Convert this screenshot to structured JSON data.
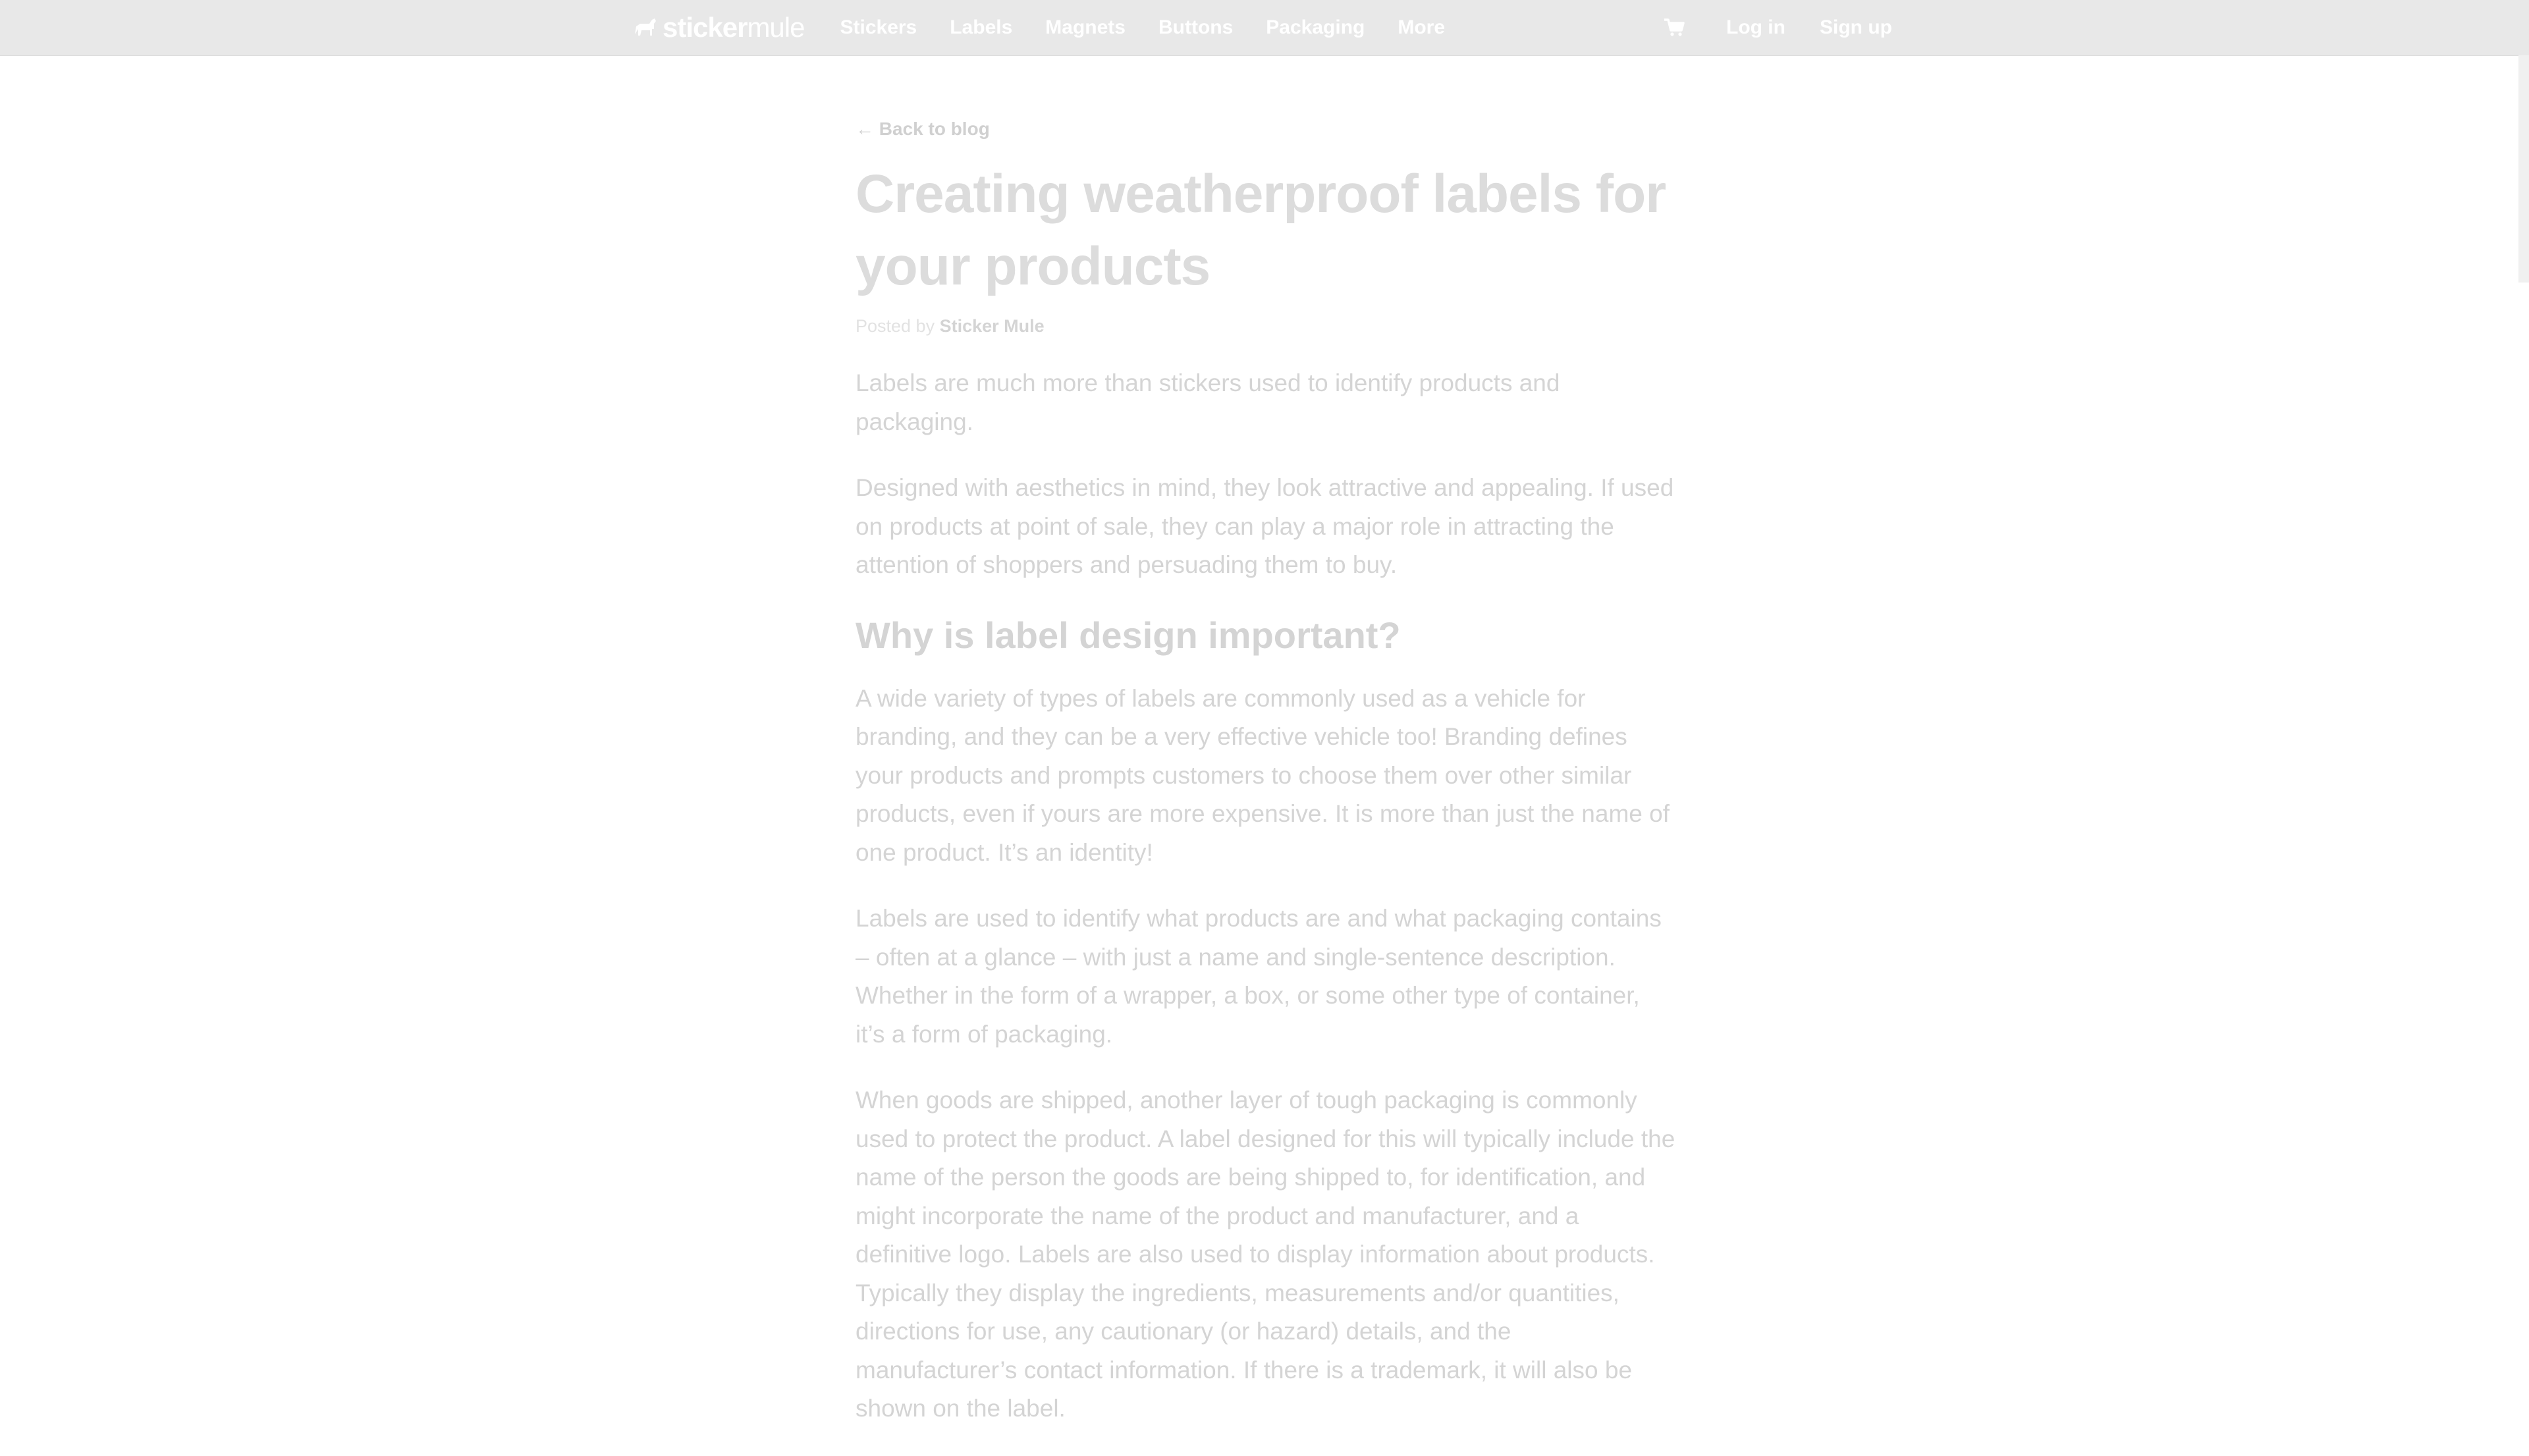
{
  "nav": {
    "logo_bold": "sticker",
    "logo_light": "mule",
    "links": [
      "Stickers",
      "Labels",
      "Magnets",
      "Buttons",
      "Packaging",
      "More"
    ],
    "login": "Log in",
    "signup": "Sign up"
  },
  "article": {
    "back": "← Back to blog",
    "title": "Creating weatherproof labels for your products",
    "posted_prefix": "Posted by",
    "author": "Sticker Mule",
    "p1": "Labels are much more than stickers used to identify products and packaging.",
    "p2": "Designed with aesthetics in mind, they look attractive and appealing. If used on products at point of sale, they can play a major role in attracting the attention of shoppers and persuading them to buy.",
    "h2": "Why is label design important?",
    "p3": "A wide variety of types of labels are commonly used as a vehicle for branding, and they can be a very effective vehicle too! Branding defines your products and prompts customers to choose them over other similar products, even if yours are more expensive. It is more than just the name of one product. It’s an identity!",
    "p4": "Labels are used to identify what products are and what packaging contains – often at a glance – with just a name and single-sentence description. Whether in the form of a wrapper, a box, or some other type of container, it’s a form of packaging.",
    "p5": "When goods are shipped, another layer of tough packaging is commonly used to protect the product. A label designed for this will typically include the name of the person the goods are being shipped to, for identification, and might incorporate the name of the product and manufacturer, and a definitive logo. Labels are also used to display information about products. Typically they display the ingredients, measurements and/or quantities, directions for use, any cautionary (or hazard) details, and the manufacturer’s contact information. If there is a trademark, it will also be shown on the label."
  }
}
